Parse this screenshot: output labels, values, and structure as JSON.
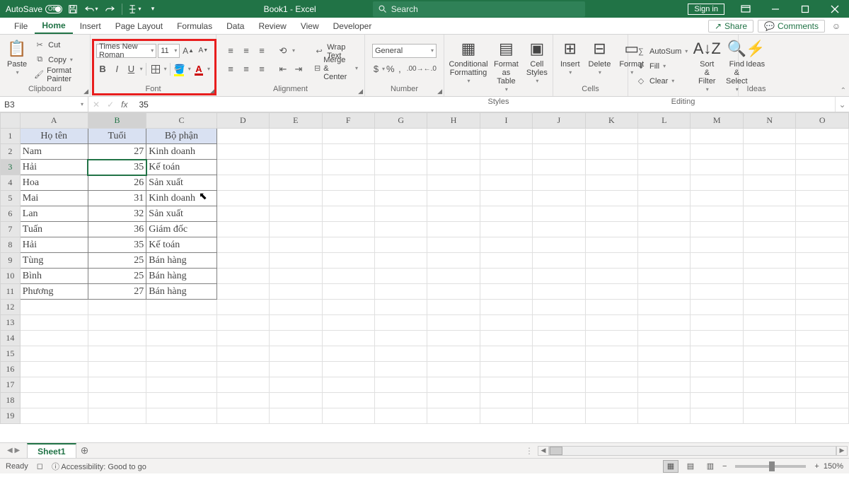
{
  "titlebar": {
    "autosave_label": "AutoSave",
    "autosave_state": "Off",
    "doc_title": "Book1  -  Excel",
    "search_placeholder": "Search",
    "sign_in": "Sign in"
  },
  "tabs": {
    "items": [
      "File",
      "Home",
      "Insert",
      "Page Layout",
      "Formulas",
      "Data",
      "Review",
      "View",
      "Developer"
    ],
    "active_index": 1,
    "share": "Share",
    "comments": "Comments"
  },
  "ribbon": {
    "clipboard": {
      "label": "Clipboard",
      "paste": "Paste",
      "cut": "Cut",
      "copy": "Copy",
      "fmtpaint": "Format Painter"
    },
    "font": {
      "label": "Font",
      "name": "Times New Roman",
      "size": "11"
    },
    "alignment": {
      "label": "Alignment",
      "wrap": "Wrap Text",
      "merge": "Merge & Center"
    },
    "number": {
      "label": "Number",
      "format": "General"
    },
    "styles": {
      "label": "Styles",
      "cond": "Conditional Formatting",
      "table": "Format as Table",
      "cell": "Cell Styles"
    },
    "cells": {
      "label": "Cells",
      "insert": "Insert",
      "delete": "Delete",
      "format": "Format"
    },
    "editing": {
      "label": "Editing",
      "autosum": "AutoSum",
      "fill": "Fill",
      "clear": "Clear",
      "sort": "Sort & Filter",
      "find": "Find & Select"
    },
    "ideas": {
      "label": "Ideas",
      "btn": "Ideas"
    }
  },
  "formula_bar": {
    "name_box": "B3",
    "formula": "35"
  },
  "grid": {
    "columns": [
      "A",
      "B",
      "C",
      "D",
      "E",
      "F",
      "G",
      "H",
      "I",
      "J",
      "K",
      "L",
      "M",
      "N",
      "O"
    ],
    "headers": [
      "Họ tên",
      "Tuổi",
      "Bộ phận"
    ],
    "rows": [
      {
        "a": "Nam",
        "b": 27,
        "c": "Kinh doanh"
      },
      {
        "a": "Hải",
        "b": 35,
        "c": "Kế toán"
      },
      {
        "a": "Hoa",
        "b": 26,
        "c": "Sản xuất"
      },
      {
        "a": "Mai",
        "b": 31,
        "c": "Kinh doanh"
      },
      {
        "a": "Lan",
        "b": 32,
        "c": "Sản xuất"
      },
      {
        "a": "Tuấn",
        "b": 36,
        "c": "Giám đốc"
      },
      {
        "a": "Hải",
        "b": 35,
        "c": "Kế toán"
      },
      {
        "a": "Tùng",
        "b": 25,
        "c": "Bán hàng"
      },
      {
        "a": "Bình",
        "b": 25,
        "c": "Bán hàng"
      },
      {
        "a": "Phương",
        "b": 27,
        "c": "Bán hàng"
      }
    ],
    "active_cell": "B3",
    "selected_col": "B",
    "selected_row": 3
  },
  "sheet_tabs": {
    "active": "Sheet1"
  },
  "status": {
    "ready": "Ready",
    "access": "Accessibility: Good to go",
    "zoom": "150%"
  }
}
